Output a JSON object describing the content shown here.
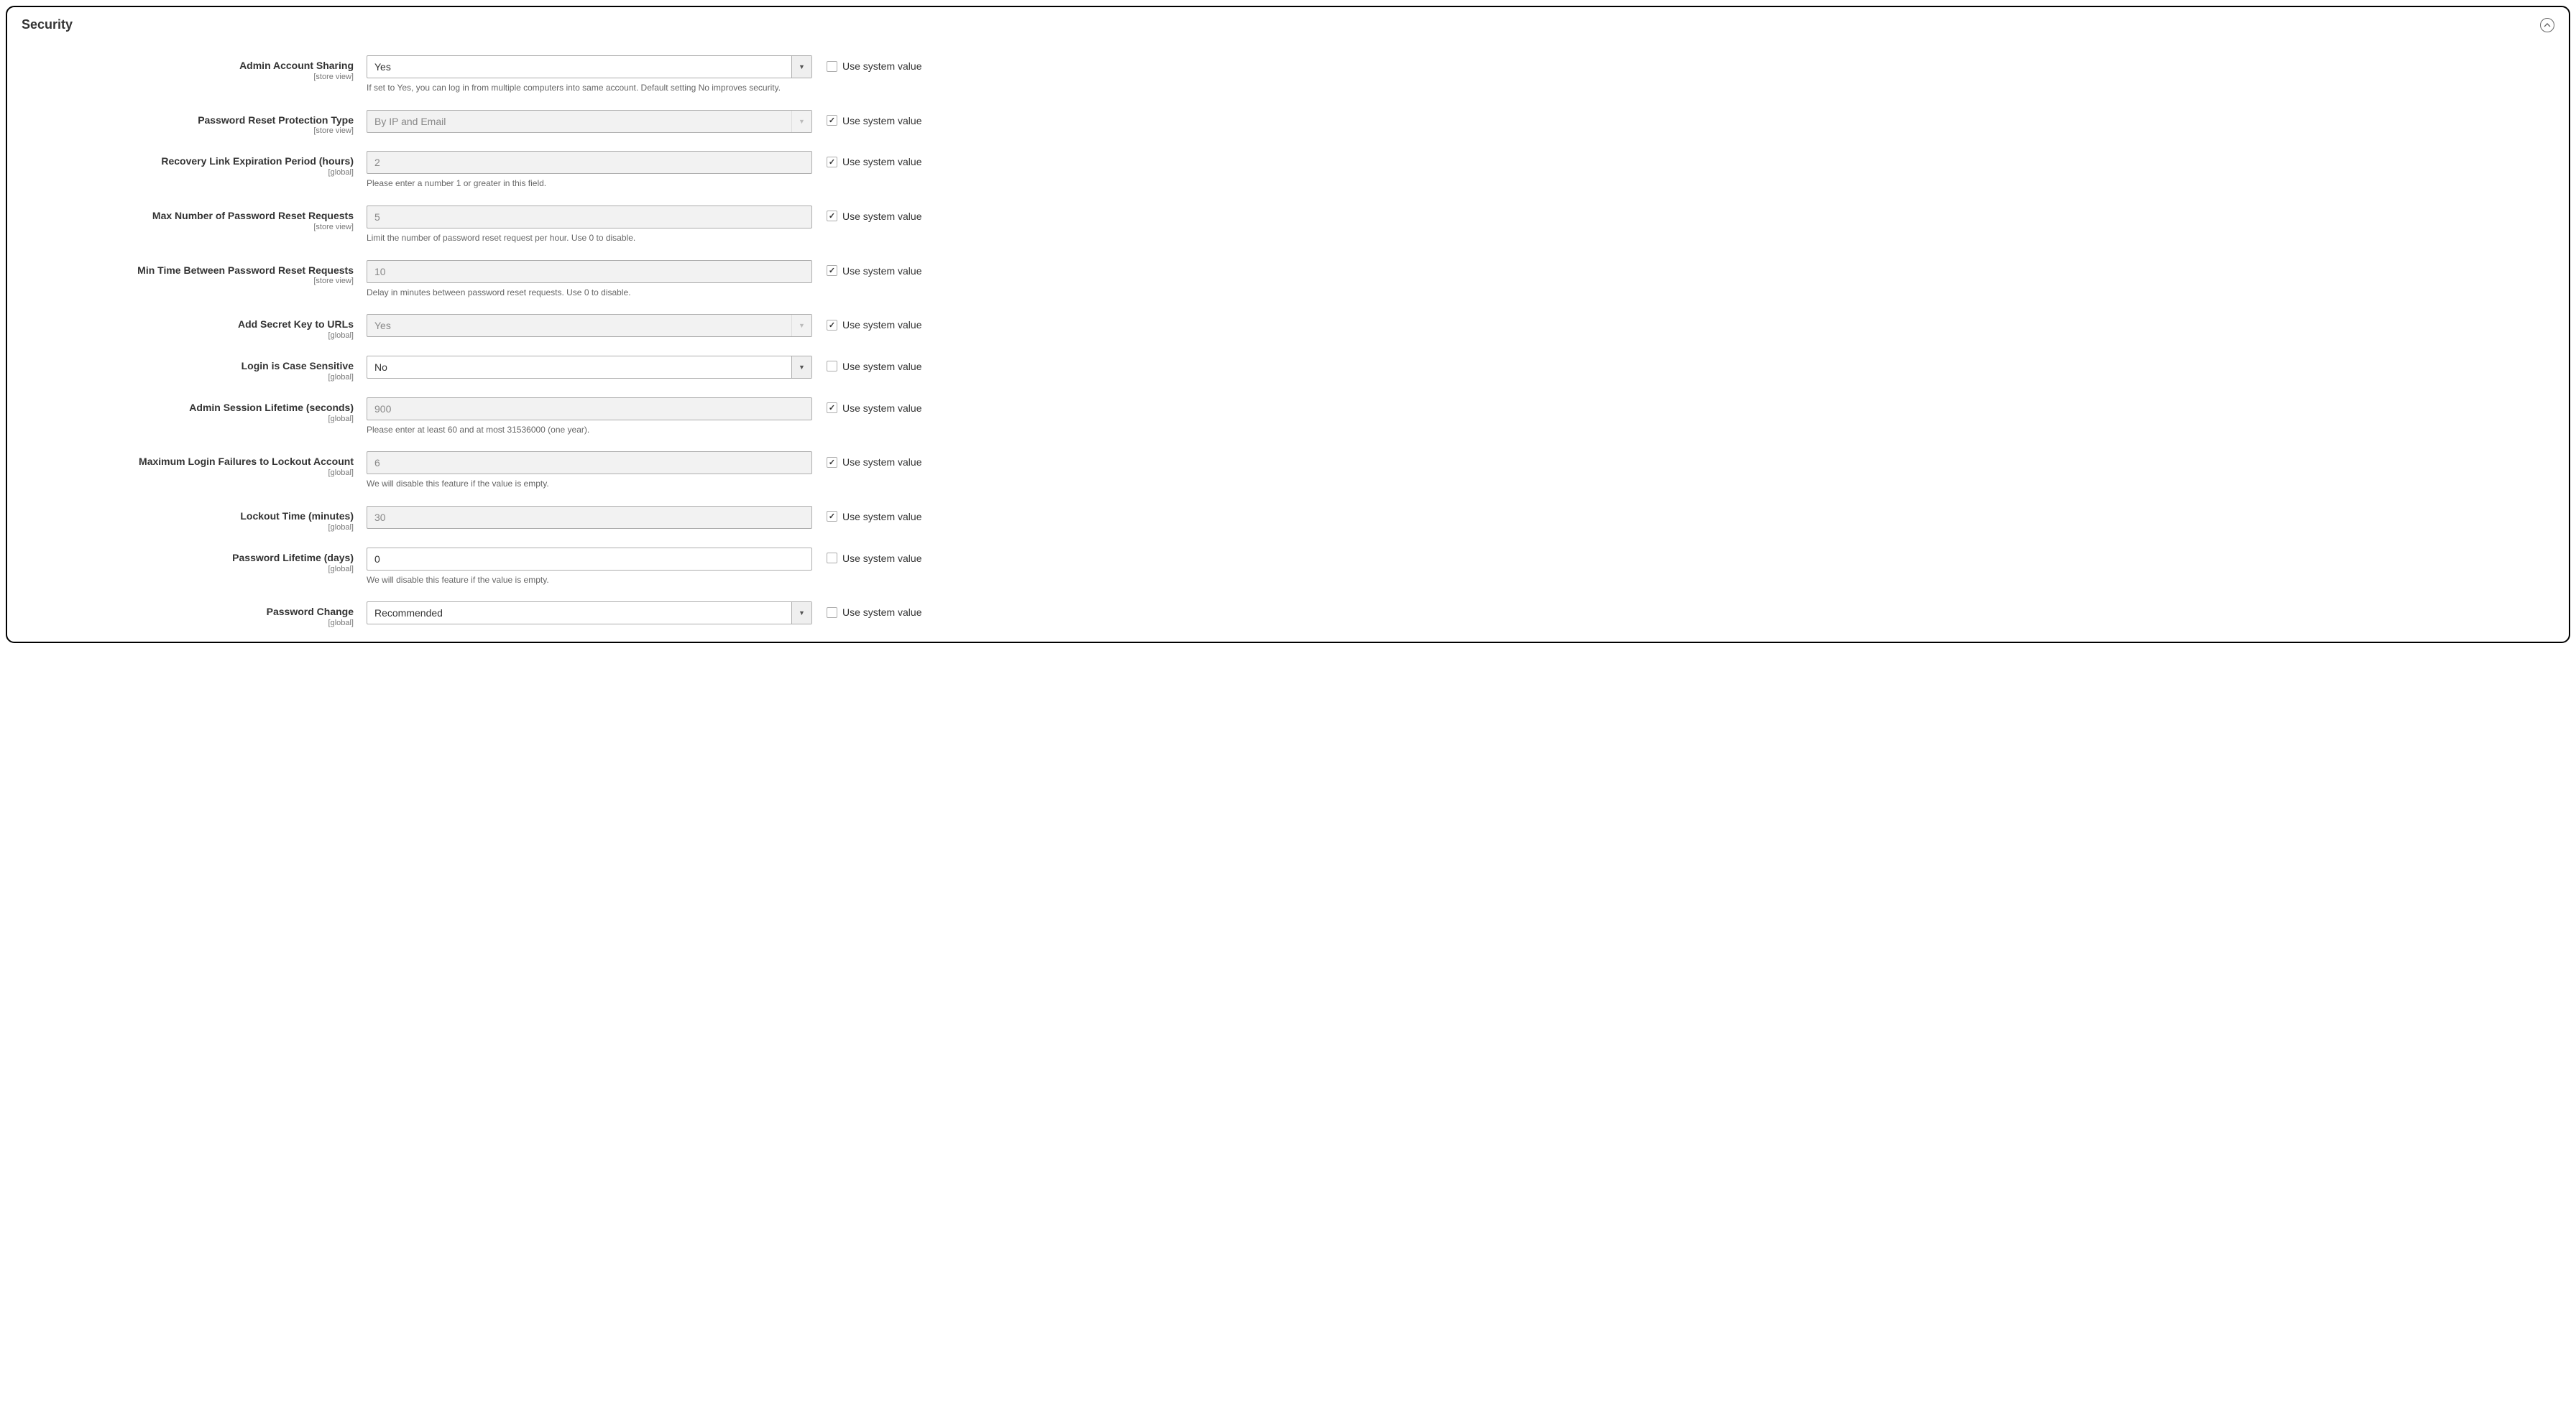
{
  "panel_title": "Security",
  "use_system_value_label": "Use system value",
  "scope_global": "[global]",
  "scope_store_view": "[store view]",
  "fields": {
    "admin_account_sharing": {
      "label": "Admin Account Sharing",
      "value": "Yes",
      "help": "If set to Yes, you can log in from multiple computers into same account. Default setting No improves security."
    },
    "pw_reset_protection": {
      "label": "Password Reset Protection Type",
      "value": "By IP and Email"
    },
    "recovery_link_exp": {
      "label": "Recovery Link Expiration Period (hours)",
      "value": "2",
      "help": "Please enter a number 1 or greater in this field."
    },
    "max_pw_reset_requests": {
      "label": "Max Number of Password Reset Requests",
      "value": "5",
      "help": "Limit the number of password reset request per hour. Use 0 to disable."
    },
    "min_time_between_pw_reset": {
      "label": "Min Time Between Password Reset Requests",
      "value": "10",
      "help": "Delay in minutes between password reset requests. Use 0 to disable."
    },
    "add_secret_key": {
      "label": "Add Secret Key to URLs",
      "value": "Yes"
    },
    "login_case_sensitive": {
      "label": "Login is Case Sensitive",
      "value": "No"
    },
    "session_lifetime": {
      "label": "Admin Session Lifetime (seconds)",
      "value": "900",
      "help": "Please enter at least 60 and at most 31536000 (one year)."
    },
    "max_login_failures": {
      "label": "Maximum Login Failures to Lockout Account",
      "value": "6",
      "help": "We will disable this feature if the value is empty."
    },
    "lockout_time": {
      "label": "Lockout Time (minutes)",
      "value": "30"
    },
    "password_lifetime": {
      "label": "Password Lifetime (days)",
      "value": "0",
      "help": "We will disable this feature if the value is empty."
    },
    "password_change": {
      "label": "Password Change",
      "value": "Recommended"
    }
  }
}
